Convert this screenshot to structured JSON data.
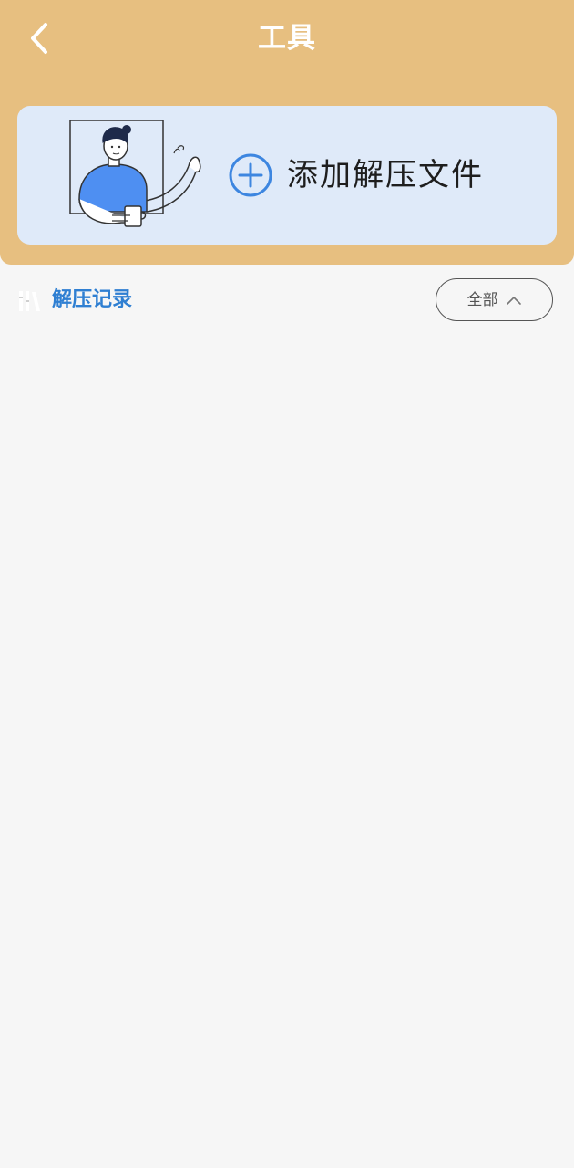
{
  "header": {
    "title": "工具",
    "background_color": "#e7bf80"
  },
  "add_card": {
    "label": "添加解压文件",
    "background_color": "#dfeaf9",
    "accent_color": "#3d86e0"
  },
  "records": {
    "title": "解压记录",
    "title_color": "#2f7fd2",
    "filter": {
      "selected": "全部"
    },
    "items": []
  },
  "icons": {
    "back": "chevron-left-icon",
    "add": "plus-circle-icon",
    "records": "records-icon",
    "filter": "chevron-up-icon"
  }
}
